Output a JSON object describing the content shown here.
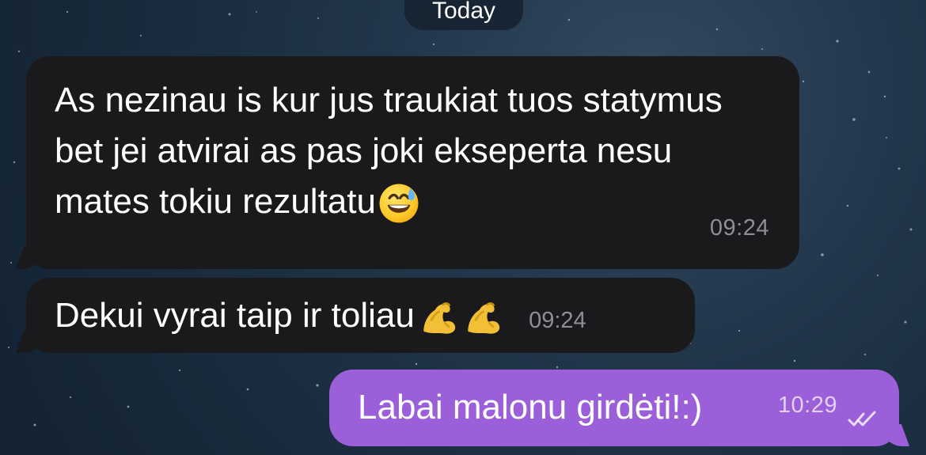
{
  "date_pill": {
    "label": "Today"
  },
  "messages": [
    {
      "text": "As nezinau is kur jus traukiat tuos statymus bet jei atvirai as pas joki ekseperta nesu mates tokiu rezultatu",
      "emoji": "grinning-face-with-sweat-icon",
      "time": "09:24"
    },
    {
      "text": "Dekui vyrai taip ir toliau",
      "emoji": "flexed-biceps-icon",
      "time": "09:24"
    },
    {
      "text": "Labai malonu girdėti!:)",
      "time": "10:29",
      "status": "double-check-icon"
    }
  ],
  "colors": {
    "background": "#1f3146",
    "incoming_bubble": "#1a1a1d",
    "outgoing_bubble": "#9b5fda",
    "timestamp": "#8d8f95",
    "text": "#ffffff"
  }
}
